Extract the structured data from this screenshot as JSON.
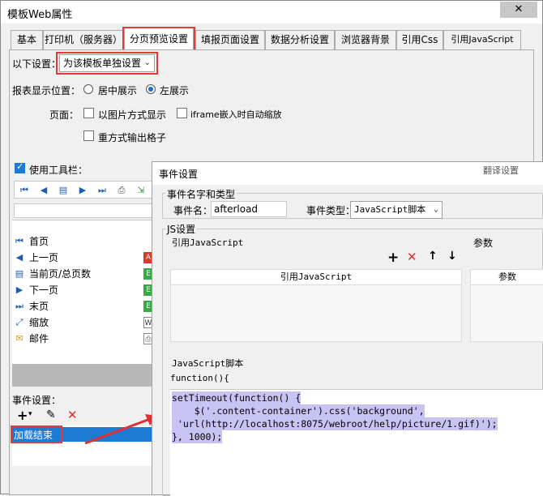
{
  "window": {
    "title": "模板Web属性",
    "close_icon": "✕"
  },
  "tabs": [
    {
      "label": "基本"
    },
    {
      "label": "打印机（服务器）"
    },
    {
      "label": "分页预览设置"
    },
    {
      "label": "填报页面设置"
    },
    {
      "label": "数据分析设置"
    },
    {
      "label": "浏览器背景"
    },
    {
      "label": "引用Css"
    },
    {
      "label": "引用JavaScript"
    }
  ],
  "settings": {
    "mode_label": "以下设置：",
    "mode_value": "为该模板单独设置",
    "position_label": "报表显示位置：",
    "position_center": "居中展示",
    "position_left": "左展示",
    "page_label": "页面：",
    "opt_image": "以图片方式显示",
    "opt_iframe": "iframe嵌入时自动缩放",
    "opt_output": "重方式输出格子",
    "use_toolbar": "使用工具栏："
  },
  "toolbar_items": [
    {
      "label": "首页",
      "icon": "⏮"
    },
    {
      "label": "上一页",
      "icon": "◀"
    },
    {
      "label": "当前页/总页数",
      "icon": "▤"
    },
    {
      "label": "下一页",
      "icon": "▶"
    },
    {
      "label": "末页",
      "icon": "⏭"
    },
    {
      "label": "缩放",
      "icon": "⤢"
    },
    {
      "label": "邮件",
      "icon": "✉"
    }
  ],
  "events": {
    "label": "事件设置：",
    "items": [
      "加载结束"
    ]
  },
  "dialog": {
    "title": "事件设置",
    "bg_title": "翻译设置",
    "name_type_group": "事件名字和类型",
    "name_label": "事件名：",
    "name_value": "afterload",
    "type_label": "事件类型：",
    "type_value": "JavaScript脚本",
    "js_group": "JS设置",
    "ref_js_label": "引用JavaScript",
    "params_label": "参数",
    "ref_js_col": "引用JavaScript",
    "params_col": "参数",
    "script_label": "JavaScript脚本",
    "fn_header": "function(){",
    "code": [
      "setTimeout(function() {",
      "    $('.content-container').css('background',",
      " 'url(http://localhost:8075/webroot/help/picture/1.gif)');",
      "}, 1000);"
    ]
  }
}
